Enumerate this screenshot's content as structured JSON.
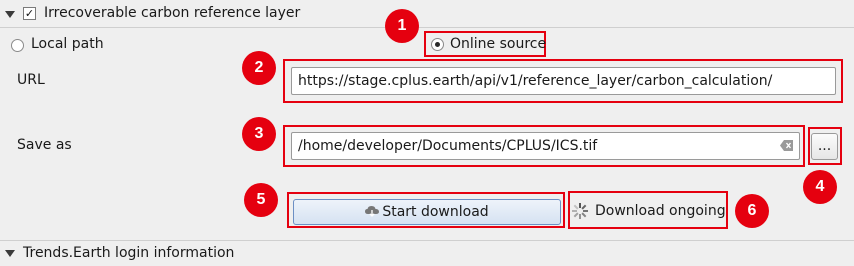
{
  "group": {
    "title": "Irrecoverable carbon reference layer",
    "checked": true
  },
  "source": {
    "local_label": "Local path",
    "online_label": "Online source",
    "selected": "online"
  },
  "url": {
    "label": "URL",
    "value": "https://stage.cplus.earth/api/v1/reference_layer/carbon_calculation/"
  },
  "save_as": {
    "label": "Save as",
    "value": "/home/developer/Documents/CPLUS/ICS.tif",
    "browse_label": "..."
  },
  "download": {
    "start_label": "Start download",
    "status_label": "Download ongoing"
  },
  "collapsed_group": {
    "title": "Trends.Earth login information"
  },
  "badges": [
    "1",
    "2",
    "3",
    "4",
    "5",
    "6"
  ],
  "colors": {
    "annotation_red": "#e5000f",
    "button_border": "#6c8fc4"
  }
}
